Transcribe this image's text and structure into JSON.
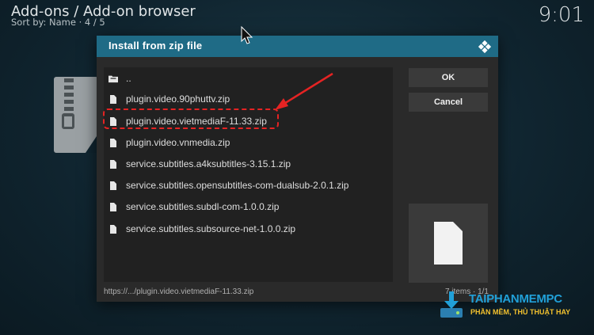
{
  "background": {
    "title": "Add-ons / Add-on browser",
    "subtitle": "Sort by: Name  ·  4 / 5",
    "clock": "9:01"
  },
  "dialog": {
    "title": "Install from zip file",
    "items": [
      {
        "label": "..",
        "icon": "folder-up-icon"
      },
      {
        "label": "plugin.video.90phuttv.zip",
        "icon": "file-icon"
      },
      {
        "label": "plugin.video.vietmediaF-11.33.zip",
        "icon": "file-icon"
      },
      {
        "label": "plugin.video.vnmedia.zip",
        "icon": "file-icon"
      },
      {
        "label": "service.subtitles.a4ksubtitles-3.15.1.zip",
        "icon": "file-icon"
      },
      {
        "label": "service.subtitles.opensubtitles-com-dualsub-2.0.1.zip",
        "icon": "file-icon"
      },
      {
        "label": "service.subtitles.subdl-com-1.0.0.zip",
        "icon": "file-icon"
      },
      {
        "label": "service.subtitles.subsource-net-1.0.0.zip",
        "icon": "file-icon"
      }
    ],
    "ok_label": "OK",
    "cancel_label": "Cancel",
    "path": "https://.../plugin.video.vietmediaF-11.33.zip",
    "count": "7 items · 1/1"
  },
  "watermark": {
    "name": "TAIPHANMEMPC",
    "slogan": "PHẦN MỀM, THỦ THUẬT HAY"
  },
  "colors": {
    "header": "#1f6b86",
    "annotation": "#e52323",
    "watermark_blue": "#21a0d8",
    "watermark_yellow": "#f2c12e"
  }
}
